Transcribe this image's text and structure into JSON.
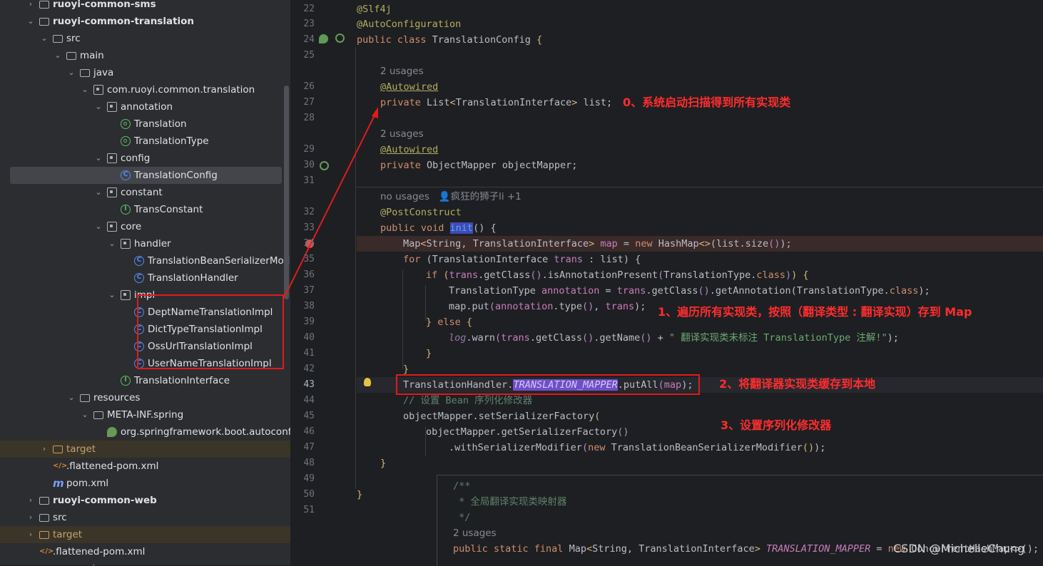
{
  "project_tree": {
    "items": [
      {
        "label": "ruoyi-common-sms",
        "icon": "module-folder-icon",
        "arrow": "right",
        "depth": 3,
        "bold": true
      },
      {
        "label": "ruoyi-common-translation",
        "icon": "module-folder-icon",
        "arrow": "down",
        "depth": 3,
        "bold": true
      },
      {
        "label": "src",
        "icon": "folder-icon",
        "arrow": "down",
        "depth": 4
      },
      {
        "label": "main",
        "icon": "folder-icon",
        "arrow": "down",
        "depth": 5
      },
      {
        "label": "java",
        "icon": "source-folder-icon",
        "arrow": "down",
        "depth": 6
      },
      {
        "label": "com.ruoyi.common.translation",
        "icon": "package-icon",
        "arrow": "down",
        "depth": 7
      },
      {
        "label": "annotation",
        "icon": "package-icon",
        "arrow": "down",
        "depth": 8
      },
      {
        "label": "Translation",
        "icon": "annotation-icon",
        "arrow": "",
        "depth": 9
      },
      {
        "label": "TranslationType",
        "icon": "annotation-icon",
        "arrow": "",
        "depth": 9
      },
      {
        "label": "config",
        "icon": "package-icon",
        "arrow": "down",
        "depth": 8
      },
      {
        "label": "TranslationConfig",
        "icon": "class-icon",
        "arrow": "",
        "depth": 9,
        "selected": true
      },
      {
        "label": "constant",
        "icon": "package-icon",
        "arrow": "down",
        "depth": 8
      },
      {
        "label": "TransConstant",
        "icon": "interface-icon",
        "arrow": "",
        "depth": 9
      },
      {
        "label": "core",
        "icon": "package-icon",
        "arrow": "down",
        "depth": 8
      },
      {
        "label": "handler",
        "icon": "package-icon",
        "arrow": "down",
        "depth": 9
      },
      {
        "label": "TranslationBeanSerializerModifier",
        "icon": "class-icon",
        "arrow": "",
        "depth": 10
      },
      {
        "label": "TranslationHandler",
        "icon": "class-icon",
        "arrow": "",
        "depth": 10
      },
      {
        "label": "impl",
        "icon": "package-icon",
        "arrow": "down",
        "depth": 9
      },
      {
        "label": "DeptNameTranslationImpl",
        "icon": "class-icon",
        "arrow": "",
        "depth": 10
      },
      {
        "label": "DictTypeTranslationImpl",
        "icon": "class-icon",
        "arrow": "",
        "depth": 10
      },
      {
        "label": "OssUrlTranslationImpl",
        "icon": "class-icon",
        "arrow": "",
        "depth": 10
      },
      {
        "label": "UserNameTranslationImpl",
        "icon": "class-icon",
        "arrow": "",
        "depth": 10
      },
      {
        "label": "TranslationInterface",
        "icon": "interface-icon",
        "arrow": "",
        "depth": 9
      },
      {
        "label": "resources",
        "icon": "resources-folder-icon",
        "arrow": "down",
        "depth": 6
      },
      {
        "label": "META-INF.spring",
        "icon": "folder-icon",
        "arrow": "down",
        "depth": 7
      },
      {
        "label": "org.springframework.boot.autoconfigure.AutoConfiguration.imports",
        "icon": "spring-icon",
        "arrow": "",
        "depth": 8
      },
      {
        "label": "target",
        "icon": "excluded-folder-icon",
        "arrow": "right",
        "depth": 4,
        "excluded": true
      },
      {
        "label": ".flattened-pom.xml",
        "icon": "xml-icon",
        "arrow": "",
        "depth": 4
      },
      {
        "label": "pom.xml",
        "icon": "maven-icon",
        "arrow": "",
        "depth": 4
      },
      {
        "label": "ruoyi-common-web",
        "icon": "module-folder-icon",
        "arrow": "right",
        "depth": 3,
        "bold": true
      },
      {
        "label": "src",
        "icon": "folder-icon",
        "arrow": "right",
        "depth": 3
      },
      {
        "label": "target",
        "icon": "excluded-folder-icon",
        "arrow": "right",
        "depth": 3,
        "excluded": true
      },
      {
        "label": ".flattened-pom.xml",
        "icon": "xml-icon",
        "arrow": "",
        "depth": 3
      },
      {
        "label": "pom.xml",
        "icon": "maven-icon",
        "arrow": "",
        "depth": 3
      }
    ]
  },
  "gutter": {
    "line_numbers": [
      "22",
      "23",
      "24",
      "25",
      "26",
      "27",
      "28",
      "29",
      "30",
      "31",
      "32",
      "33",
      "34",
      "35",
      "36",
      "37",
      "38",
      "39",
      "40",
      "41",
      "42",
      "43",
      "44",
      "45",
      "46",
      "47",
      "48",
      "49",
      "50",
      "51"
    ],
    "current_line": "43"
  },
  "code": {
    "l22": "@Slf4j",
    "l23": "@AutoConfiguration",
    "l24_kw": "public class ",
    "l24_name": "TranslationConfig",
    "l24_rest": " {",
    "usages_1": "2 usages",
    "usages_2": "2 usages",
    "usages_3_a": "no usages",
    "usages_3_b": "疯狂的狮子li +1",
    "usages_4": "2 usages",
    "l26": "@Autowired",
    "l27_kw": "private ",
    "l27_type": "List",
    "l27_lt": "<",
    "l27_gen": "TranslationInterface",
    "l27_gt": ">",
    "l27_rest": " list;",
    "l29": "@Autowired",
    "l30_kw": "private ",
    "l30_type": "ObjectMapper",
    "l30_rest": " objectMapper;",
    "l32": "@PostConstruct",
    "l33_kw": "public void ",
    "l33_fn": "init",
    "l33_rest": "() {",
    "l34_a": "Map",
    "l34_b": "<",
    "l34_c": "String",
    "l34_d": ", ",
    "l34_e": "TranslationInterface",
    "l34_f": ">",
    "l34_g": " map",
    "l34_h": " = ",
    "l34_i": "new ",
    "l34_j": "HashMap",
    "l34_k": "<>",
    "l34_l": "(list.size",
    "l34_m": "()",
    "l34_n": ");",
    "l35_kw": "for ",
    "l35_a": "(",
    "l35_b": "TranslationInterface",
    "l35_c": " trans",
    "l35_d": " : list) {",
    "l36_kw": "if ",
    "l36_a": "(",
    "l36_b": "trans",
    "l36_c": ".getClass",
    "l36_d": "()",
    "l36_e": ".isAnnotationPresent",
    "l36_f": "(",
    "l36_g": "TranslationType.",
    "l36_h": "class",
    "l36_i": ")",
    "l36_j": ") {",
    "l37_a": "TranslationType",
    "l37_b": " annotation",
    "l37_c": " = ",
    "l37_d": "trans",
    "l37_e": ".getClass",
    "l37_f": "()",
    "l37_g": ".getAnnotation",
    "l37_h": "(TranslationType.",
    "l37_i": "class",
    "l37_j": ");",
    "l38_a": "map",
    "l38_b": ".put",
    "l38_c": "(",
    "l38_d": "annotation",
    "l38_e": ".type",
    "l38_f": "()",
    "l38_g": ", ",
    "l38_h": "trans",
    "l38_i": ");",
    "l39_a": "} ",
    "l39_kw": "else ",
    "l39_b": "{",
    "l40_a": "log",
    "l40_b": ".warn",
    "l40_c": "(",
    "l40_d": "trans",
    "l40_e": ".getClass",
    "l40_f": "()",
    "l40_g": ".getName",
    "l40_h": "()",
    "l40_i": " + ",
    "l40_j": "\" 翻译实现类未标注 TranslationType 注解!\"",
    "l40_k": ");",
    "l41": "}",
    "l42": "}",
    "l43_a": "TranslationHandler.",
    "l43_b": "TRANSLATION_MAPPER",
    "l43_c": ".putAll",
    "l43_d": "(",
    "l43_e": "map",
    "l43_f": ");",
    "l44": "// 设置 Bean 序列化修改器",
    "l45_a": "objectMapper",
    "l45_b": ".setSerializerFactory",
    "l45_c": "(",
    "l46_a": "objectMapper",
    "l46_b": ".getSerializerFactory",
    "l46_c": "()",
    "l47_a": ".withSerializerModifier",
    "l47_b": "(",
    "l47_kw": "new ",
    "l47_c": "TranslationBeanSerializerModifier",
    "l47_d": "()",
    "l47_e": ");",
    "l49": "}",
    "l51": "}"
  },
  "popup": {
    "line1": "/**",
    "line2": " * 全局翻译实现类映射器",
    "line3": " */",
    "usages": "2 usages",
    "decl_kw": "public static final ",
    "decl_type": "Map",
    "decl_lt": "<",
    "decl_s": "String",
    "decl_c": ", ",
    "decl_t": "TranslationInterface",
    "decl_gt": ">",
    "decl_name": " TRANSLATION_MAPPER",
    "decl_eq": " = ",
    "decl_new": "new ",
    "decl_rest": "ConcurrentHashMap<>();"
  },
  "annotations": {
    "step0": "0、系统启动扫描得到所有实现类",
    "step1": "1、遍历所有实现类，按照（翻译类型 : 翻译实现）存到 Map",
    "step2": "2、将翻译器实现类缓存到本地",
    "step3": "3、设置序列化修改器"
  },
  "watermark": "CSDN @MichelleChung",
  "colors": {
    "annotation_red": "#e11b1b",
    "selection_bg": "#43454a",
    "breakpoint_line_bg": "#3a2a2a",
    "current_line_bg": "#26282e",
    "highlight_mapper": "#6f4fc4"
  }
}
